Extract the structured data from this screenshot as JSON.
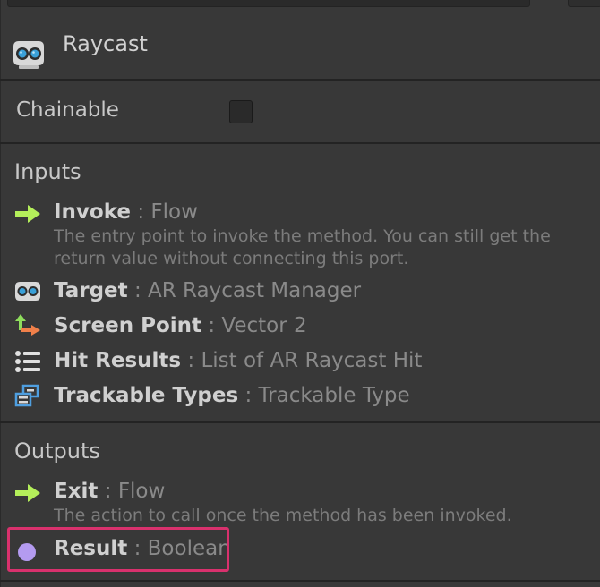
{
  "header": {
    "title": "Raycast",
    "icon": "ar-goggles-icon"
  },
  "settings": {
    "chainable_label": "Chainable",
    "chainable_checked": false
  },
  "inputs": {
    "title": "Inputs",
    "ports": [
      {
        "name": "Invoke",
        "sep": " : ",
        "type": "Flow",
        "icon": "flow-arrow-icon",
        "description": "The entry point to invoke the method. You can still get the return value without connecting this port."
      },
      {
        "name": "Target",
        "sep": " : ",
        "type": "AR Raycast Manager",
        "icon": "ar-goggles-icon"
      },
      {
        "name": "Screen Point",
        "sep": " : ",
        "type": "Vector 2",
        "icon": "vector2-axes-icon"
      },
      {
        "name": "Hit Results",
        "sep": " : ",
        "type": "List of AR Raycast Hit",
        "icon": "list-icon"
      },
      {
        "name": "Trackable Types",
        "sep": " : ",
        "type": "Trackable Type",
        "icon": "enum-icon"
      }
    ]
  },
  "outputs": {
    "title": "Outputs",
    "ports": [
      {
        "name": "Exit",
        "sep": " : ",
        "type": "Flow",
        "icon": "flow-arrow-icon",
        "description": "The action to call once the method has been invoked."
      },
      {
        "name": "Result",
        "sep": " : ",
        "type": "Boolean",
        "icon": "boolean-dot-icon"
      }
    ]
  },
  "colors": {
    "background": "#383838",
    "flow_arrow": "#b4ef5a",
    "boolean_dot": "#b49bf0",
    "highlight_border": "#d9316d",
    "vector_green": "#8edd5c",
    "vector_orange": "#f0804a",
    "enum_blue": "#4f9fe0"
  }
}
